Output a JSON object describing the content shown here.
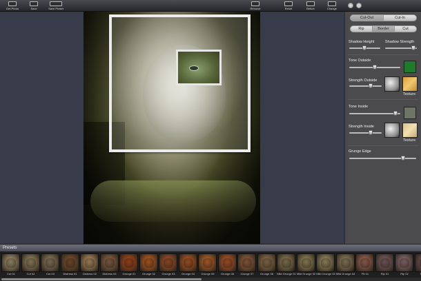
{
  "toolbar": {
    "get_photo": "Get Photo",
    "save": "Save",
    "save_preset": "Save Preset",
    "remove": "Remove",
    "reset": "Reset",
    "before": "Before",
    "change": "Change"
  },
  "panel": {
    "mode_segment": [
      "Cut-Out",
      "Cut-In"
    ],
    "mode_selected": "Cut-Out",
    "edge_segment": [
      "Rip",
      "Border",
      "Cut"
    ],
    "edge_selected": "Border",
    "shadow_height_label": "Shadow Height",
    "shadow_strength_label": "Shadow Strength",
    "shadow_height_value": 0.5,
    "shadow_strength_value": 0.9,
    "tone_outside_label": "Tone Outside",
    "tone_outside_value": 0.5,
    "tone_outside_color": "#1f7a2c",
    "strength_outside_label": "Strength Outside",
    "strength_outside_value": 0.64,
    "texture_label_1": "Texture",
    "tone_inside_label": "Tone Inside",
    "tone_inside_value": 0.95,
    "tone_inside_color": "#6f7566",
    "strength_inside_label": "Strength Inside",
    "strength_inside_value": 0.64,
    "texture_label_2": "Texture",
    "grunge_edge_label": "Grunge Edge",
    "grunge_edge_value": 0.8
  },
  "presets": {
    "title": "Presets",
    "items": [
      {
        "label": "Cut 01",
        "icon": "tree-thumb",
        "color": "#b8a680"
      },
      {
        "label": "Cut 02",
        "icon": "tree-thumb",
        "color": "#a89670"
      },
      {
        "label": "Cut 03",
        "icon": "tree-thumb",
        "color": "#9c8b6a"
      },
      {
        "label": "Distress 01",
        "icon": "landscape-thumb",
        "color": "#8a5a35"
      },
      {
        "label": "Distress 02",
        "icon": "landscape-thumb",
        "color": "#c8a070"
      },
      {
        "label": "Distress 03",
        "icon": "landscape-thumb",
        "color": "#9a7050"
      },
      {
        "label": "Grunge 01",
        "icon": "sunset-thumb",
        "color": "#c05020"
      },
      {
        "label": "Grunge 02",
        "icon": "sunset-thumb",
        "color": "#d06a28"
      },
      {
        "label": "Grunge 03",
        "icon": "sunset-thumb",
        "color": "#b45a30"
      },
      {
        "label": "Grunge 04",
        "icon": "sunset-thumb",
        "color": "#c4622c"
      },
      {
        "label": "Grunge 05",
        "icon": "sunset-thumb",
        "color": "#d07030"
      },
      {
        "label": "Grunge 06",
        "icon": "sunset-thumb",
        "color": "#c86030"
      },
      {
        "label": "Grunge 07",
        "icon": "sunset-thumb",
        "color": "#a46a48"
      },
      {
        "label": "Grunge 08",
        "icon": "sunset-thumb",
        "color": "#a08058"
      },
      {
        "label": "Mild Grunge 01",
        "icon": "cat-thumb",
        "color": "#9a8a60"
      },
      {
        "label": "Mild Grunge 02",
        "icon": "cat-thumb",
        "color": "#a89868"
      },
      {
        "label": "Mild Grunge 03",
        "icon": "cat-thumb",
        "color": "#b0a070"
      },
      {
        "label": "Mild Grunge 04",
        "icon": "cat-thumb",
        "color": "#a0906a"
      },
      {
        "label": "Pit 01",
        "icon": "building-thumb",
        "color": "#b07060"
      },
      {
        "label": "Rip 01",
        "icon": "people-thumb",
        "color": "#8a6a70"
      },
      {
        "label": "Rip 02",
        "icon": "people-thumb",
        "color": "#9c7a80"
      },
      {
        "label": "Rip 03",
        "icon": "people-thumb",
        "color": "#7a5a60"
      }
    ]
  }
}
